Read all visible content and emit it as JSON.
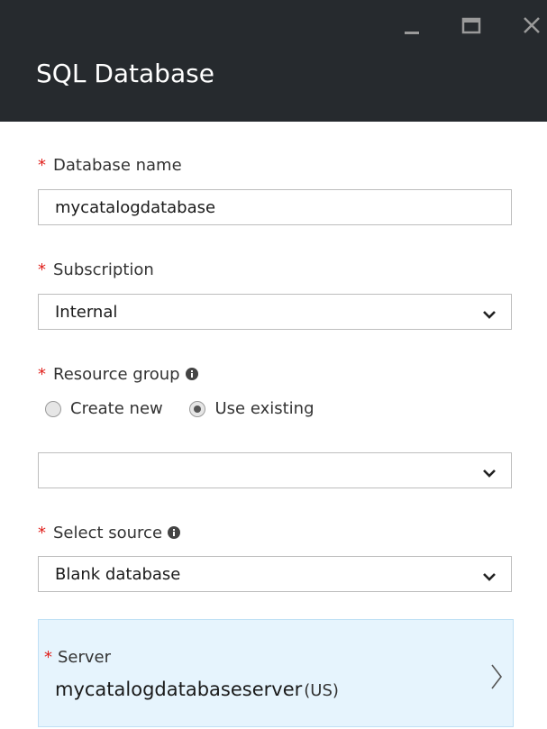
{
  "window": {
    "title": "SQL Database",
    "controls": {
      "minimize_icon": "minimize-icon",
      "maximize_icon": "maximize-icon",
      "close_icon": "close-icon"
    }
  },
  "form": {
    "required_marker": "*",
    "database_name": {
      "label": "Database name",
      "value": "mycatalogdatabase"
    },
    "subscription": {
      "label": "Subscription",
      "value": "Internal"
    },
    "resource_group": {
      "label": "Resource group",
      "options": [
        "Create new",
        "Use existing"
      ],
      "selected": "Use existing",
      "value": ""
    },
    "select_source": {
      "label": "Select source",
      "value": "Blank database"
    },
    "server": {
      "label": "Server",
      "value": "mycatalogdatabaseserver",
      "region": "(US)"
    }
  },
  "colors": {
    "header_bg": "#262a2e",
    "required": "#e0201c",
    "server_bg": "#e6f4fd"
  }
}
